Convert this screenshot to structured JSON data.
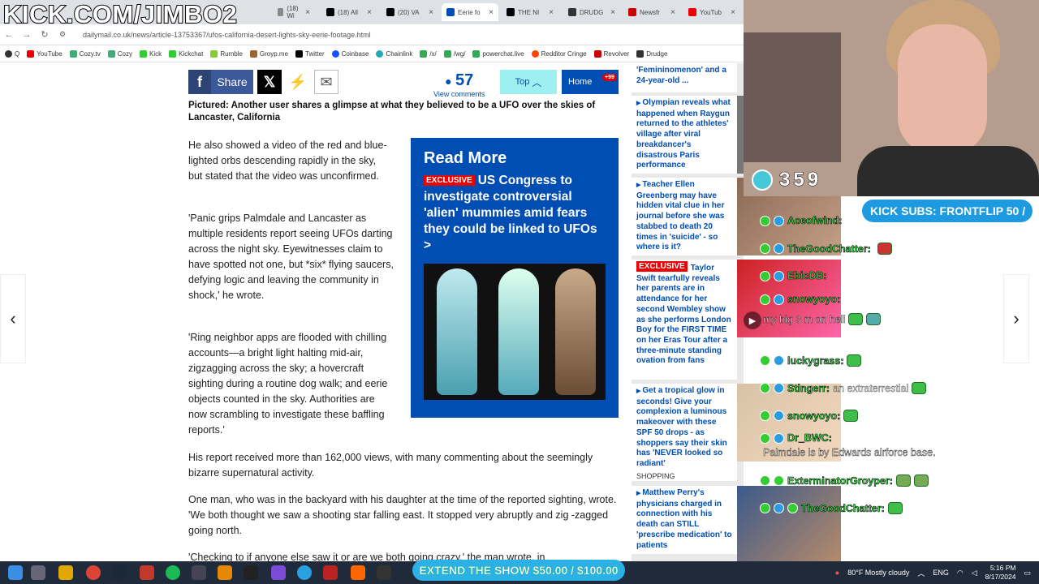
{
  "watermark": "KICK.COM/JIMBO2",
  "browser": {
    "tabs": [
      {
        "label": "(18) Wi",
        "color": "#888"
      },
      {
        "label": "(18) All",
        "color": "#000"
      },
      {
        "label": "(20) VA",
        "color": "#000"
      },
      {
        "label": "Eerie fo",
        "color": "#004db3",
        "active": true
      },
      {
        "label": "THE NI",
        "color": "#000"
      },
      {
        "label": "DRUDG",
        "color": "#333"
      },
      {
        "label": "Newsfr",
        "color": "#c00"
      },
      {
        "label": "YouTub",
        "color": "#e00"
      }
    ],
    "url": "dailymail.co.uk/news/article-13753367/ufos-california-desert-lights-sky-eerie-footage.html",
    "bookmarks": [
      {
        "label": "Q",
        "color": "#333"
      },
      {
        "label": "YouTube",
        "color": "#e00"
      },
      {
        "label": "Cozy.tv",
        "color": "#4a7"
      },
      {
        "label": "Cozy",
        "color": "#4a7"
      },
      {
        "label": "Kick",
        "color": "#3c3"
      },
      {
        "label": "Kickchat",
        "color": "#3c3"
      },
      {
        "label": "Rumble",
        "color": "#8c3"
      },
      {
        "label": "Groyp.me",
        "color": "#963"
      },
      {
        "label": "Twitter",
        "color": "#000"
      },
      {
        "label": "Coinbase",
        "color": "#15f"
      },
      {
        "label": "Chainlink",
        "color": "#2ab"
      },
      {
        "label": "/x/",
        "color": "#3a5"
      },
      {
        "label": "/wg/",
        "color": "#3a5"
      },
      {
        "label": "powerchat.live",
        "color": "#3a5"
      },
      {
        "label": "Redditor Cringe",
        "color": "#f40"
      },
      {
        "label": "Revolver",
        "color": "#c00"
      },
      {
        "label": "Drudge",
        "color": "#333"
      }
    ]
  },
  "article": {
    "share_label": "Share",
    "comment_count": "57",
    "view_comments": "View comments",
    "top_label": "Top",
    "home_label": "Home",
    "home_badge": "+99",
    "caption": "Pictured: Another user shares a glimpse at what they believed to be a UFO over the skies of Lancaster, California",
    "paragraphs": [
      "He also showed a video of the red and blue-lighted orbs descending rapidly in the sky, but stated that the video was unconfirmed.",
      "'Panic grips Palmdale and Lancaster as multiple residents report seeing UFOs darting across the night sky. Eyewitnesses claim to have spotted not one, but *six* flying saucers, defying logic and leaving the community in shock,' he wrote.",
      "'Ring neighbor apps are flooded with chilling accounts—a bright light halting mid-air, zigzagging across the sky; a hovercraft sighting during a routine dog walk; and eerie objects counted in the sky. Authorities are now scrambling to investigate these baffling reports.'",
      "His report received more than 162,000 views, with many commenting about the seemingly bizarre supernatural activity.",
      "One man, who was in the backyard with his daughter at the time of the reported sighting, wrote. 'We both thought we saw a shooting star falling east. It stopped very abruptly and zig -zagged going north.",
      "'Checking to if anyone else saw it or are we both going crazy,' the man wrote, in"
    ],
    "read_more": {
      "heading": "Read More",
      "badge": "EXCLUSIVE",
      "headline": "US Congress to investigate controversial 'alien' mummies amid fears they could be linked to UFOs >"
    }
  },
  "sidebar": {
    "items": [
      {
        "text": "'Femininomenon' and a 24-year-old ..."
      },
      {
        "text": "Olympian reveals what happened when Raygun returned to the athletes' village after viral breakdancer's disastrous Paris performance"
      },
      {
        "text": "Teacher Ellen Greenberg may have hidden vital clue in her journal before she was stabbed to death 20 times in 'suicide' - so where is it?"
      },
      {
        "badge": "EXCLUSIVE",
        "text": "Taylor Swift tearfully reveals her parents are in attendance for her second Wembley show as she performs London Boy for the FIRST TIME on her Eras Tour after a three-minute standing ovation from fans"
      },
      {
        "text": "Get a tropical glow in seconds! Give your complexion a luminous makeover with these SPF 50 drops - as shoppers say their skin has 'NEVER looked so radiant'",
        "tag": "SHOPPING"
      },
      {
        "text": "Matthew Perry's physicians charged in connection with his death can STILL 'prescribe medication' to patients"
      }
    ]
  },
  "stream": {
    "viewers": "359",
    "subs_banner": "KICK SUBS: FRONTFLIP 50 /",
    "goal": "EXTEND THE SHOW $50.00 / $100.00",
    "chat": [
      {
        "user": "Aceofwind:",
        "msg": ""
      },
      {
        "user": "TheGoodChatter:",
        "msg": ""
      },
      {
        "user": "EbicDB:",
        "msg": ""
      },
      {
        "user": "snowyoyo:",
        "msg": "my big 3 m on hell"
      },
      {
        "user": "luckygrass:",
        "msg": ""
      },
      {
        "user": "Stingerr:",
        "msg": "an extraterrestial"
      },
      {
        "user": "snowyoyo:",
        "msg": ""
      },
      {
        "user": "Dr_BWC:",
        "msg": "Palmdale is by Edwards airforce base."
      },
      {
        "user": "ExterminatorGroyper:",
        "msg": ""
      },
      {
        "user": "TheGoodChatter:",
        "msg": ""
      }
    ]
  },
  "taskbar": {
    "weather": "80°F  Mostly cloudy",
    "lang": "ENG",
    "time": "5:16 PM",
    "date": "8/17/2024"
  }
}
